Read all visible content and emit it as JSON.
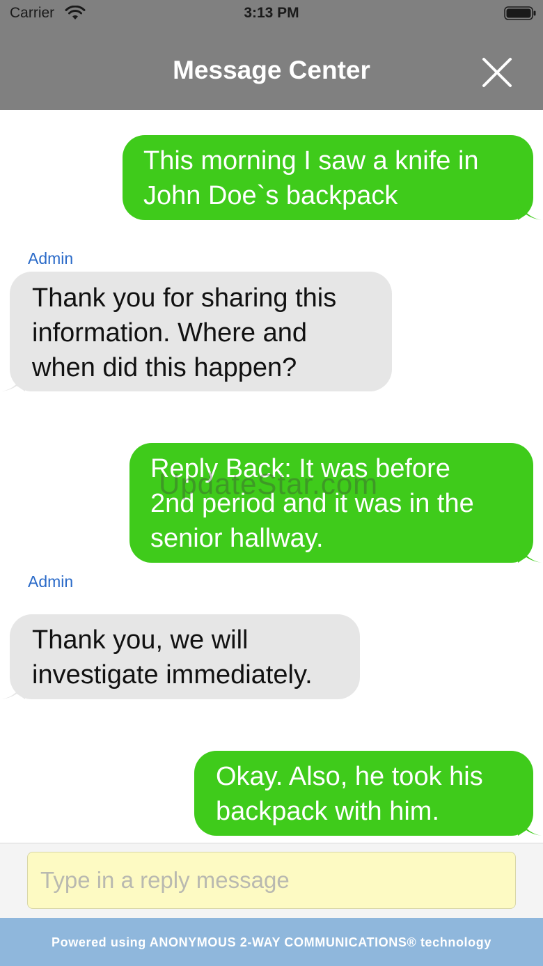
{
  "status_bar": {
    "carrier": "Carrier",
    "time": "3:13 PM",
    "wifi_icon": "wifi-icon",
    "battery_icon": "battery-icon"
  },
  "header": {
    "title": "Message Center",
    "close_icon": "close-icon"
  },
  "messages": [
    {
      "direction": "outgoing",
      "lines": [
        "This morning I saw a knife in",
        "John Doe`s backpack"
      ]
    },
    {
      "direction": "incoming",
      "sender": "Admin",
      "lines": [
        "Thank you for sharing this",
        "information. Where and",
        "when did this happen?"
      ]
    },
    {
      "direction": "outgoing",
      "lines": [
        "Reply Back: It was before",
        "2nd period and it was in the",
        "senior hallway."
      ]
    },
    {
      "direction": "incoming",
      "sender": "Admin",
      "lines": [
        "Thank you, we will",
        "investigate immediately."
      ]
    },
    {
      "direction": "outgoing",
      "lines": [
        "Okay. Also, he took his",
        "backpack with him."
      ]
    }
  ],
  "watermark": "UpdateStar.com",
  "reply": {
    "value": "",
    "placeholder": "Type in a reply message"
  },
  "footer": {
    "text": "Powered using ANONYMOUS 2-WAY COMMUNICATIONS® technology"
  },
  "colors": {
    "header_bg": "#808080",
    "outgoing_bubble": "#3fcb1b",
    "incoming_bubble": "#e6e6e6",
    "sender_label": "#2a6ac8",
    "input_bg": "#fdfac3",
    "footer_bg": "#8fb7dc"
  }
}
